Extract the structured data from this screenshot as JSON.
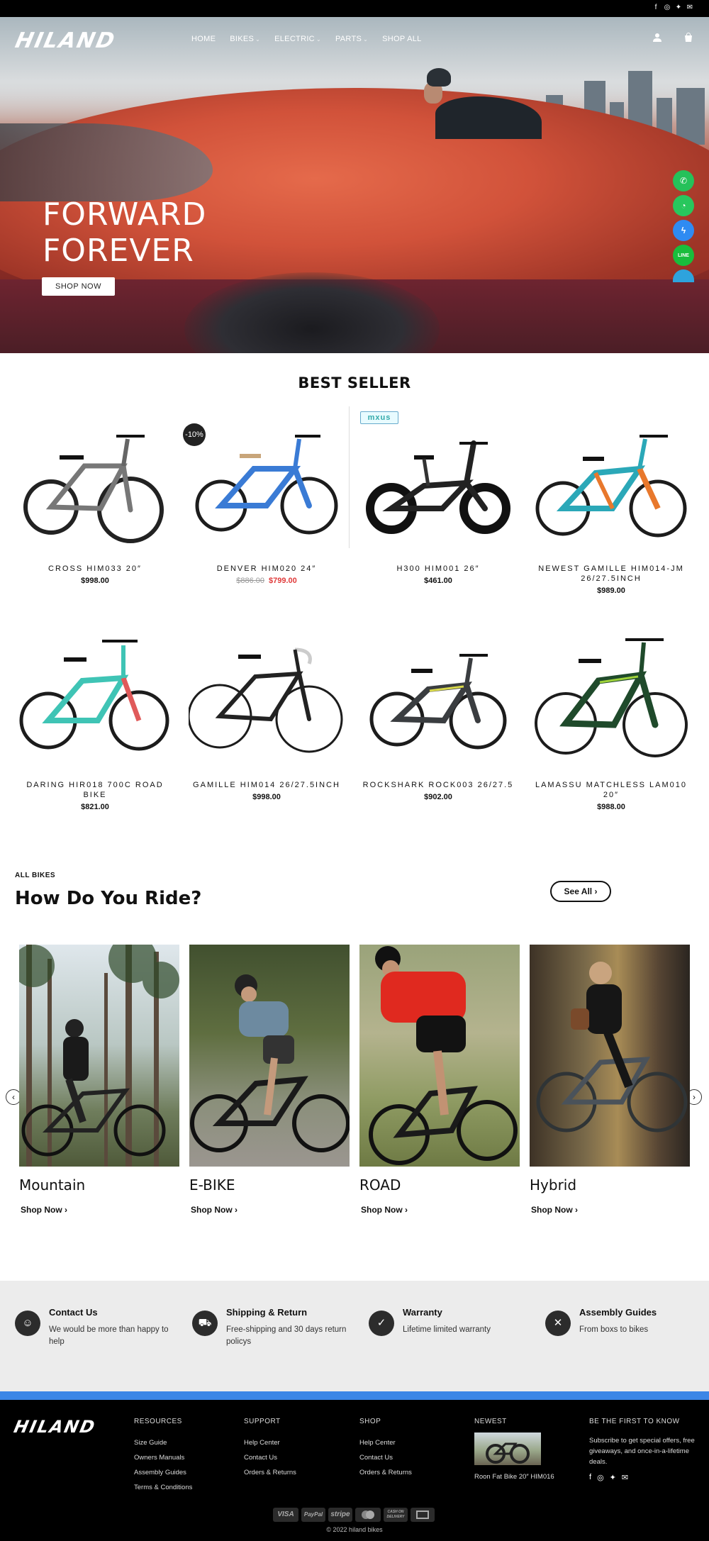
{
  "brand": {
    "logo": "HILAND"
  },
  "nav": {
    "items": [
      {
        "label": "HOME",
        "dropdown": false
      },
      {
        "label": "BIKES",
        "dropdown": true
      },
      {
        "label": "ELECTRIC",
        "dropdown": true
      },
      {
        "label": "PARTS",
        "dropdown": true
      },
      {
        "label": "SHOP ALL",
        "dropdown": false
      }
    ]
  },
  "hero": {
    "title_line1": "FORWARD",
    "title_line2": "FOREVER",
    "cta": "SHOP NOW"
  },
  "floating_contacts": [
    "phone-icon",
    "whatsapp-icon",
    "messenger-icon",
    "line-icon",
    "telegram-icon"
  ],
  "best_seller": {
    "title": "BEST SELLER",
    "badge": "-10%",
    "brand_badge": "mxus",
    "products": [
      {
        "name": "CROSS HIM033 20″",
        "price": "$998.00"
      },
      {
        "name": "DENVER HIM020 24″",
        "old_price": "$886.00",
        "price": "$799.00"
      },
      {
        "name": "H300 HIM001 26″",
        "price": "$461.00"
      },
      {
        "name": "NEWEST GAMILLE HIM014-JM 26/27.5INCH",
        "price": "$989.00"
      },
      {
        "name": "DARING HIR018 700C ROAD BIKE",
        "price": "$821.00"
      },
      {
        "name": "GAMILLE HIM014 26/27.5INCH",
        "price": "$998.00"
      },
      {
        "name": "ROCKSHARK ROCK003 26/27.5",
        "price": "$902.00"
      },
      {
        "name": "LAMASSU MATCHLESS LAM010 20″",
        "price": "$988.00"
      }
    ]
  },
  "ride": {
    "kicker": "ALL BIKES",
    "title": "How Do You Ride?",
    "see_all": "See All",
    "categories": [
      {
        "name": "Mountain",
        "link": "Shop Now"
      },
      {
        "name": "E-BIKE",
        "link": "Shop Now"
      },
      {
        "name": "ROAD",
        "link": "Shop Now"
      },
      {
        "name": "Hybrid",
        "link": "Shop Now"
      }
    ]
  },
  "features": [
    {
      "title": "Contact Us",
      "desc": "We would be more than happy to help",
      "icon": "contact-icon"
    },
    {
      "title": "Shipping & Return",
      "desc": "Free-shipping and 30 days return policys",
      "icon": "truck-icon"
    },
    {
      "title": "Warranty",
      "desc": "Lifetime limited warranty",
      "icon": "shield-icon"
    },
    {
      "title": "Assembly Guides",
      "desc": "From boxs to bikes",
      "icon": "tools-icon"
    }
  ],
  "footer": {
    "resources": {
      "title": "RESOURCES",
      "links": [
        "Size Guide",
        "Owners Manuals",
        "Assembly Guides",
        "Terms & Conditions"
      ]
    },
    "support": {
      "title": "SUPPORT",
      "links": [
        "Help Center",
        "Contact Us",
        "Orders & Returns"
      ]
    },
    "shop": {
      "title": "SHOP",
      "links": [
        "Help Center",
        "Contact Us",
        "Orders & Returns"
      ]
    },
    "newest": {
      "title": "NEWEST",
      "item": "Roon Fat Bike 20″ HIM016"
    },
    "newsletter": {
      "title": "BE THE FIRST TO KNOW",
      "text": "Subscribe to get special offers, free giveaways, and once-in-a-lifetime deals."
    },
    "payments": [
      "VISA",
      "PayPal",
      "stripe",
      "mastercard",
      "CASH ON DELIVERY",
      "bank"
    ],
    "copyright": "© 2022 hiland bikes"
  },
  "colors": {
    "accent": "#3b86e6",
    "sale": "#e03a3a",
    "footer_bg": "#000000",
    "features_bg": "#ececec"
  }
}
